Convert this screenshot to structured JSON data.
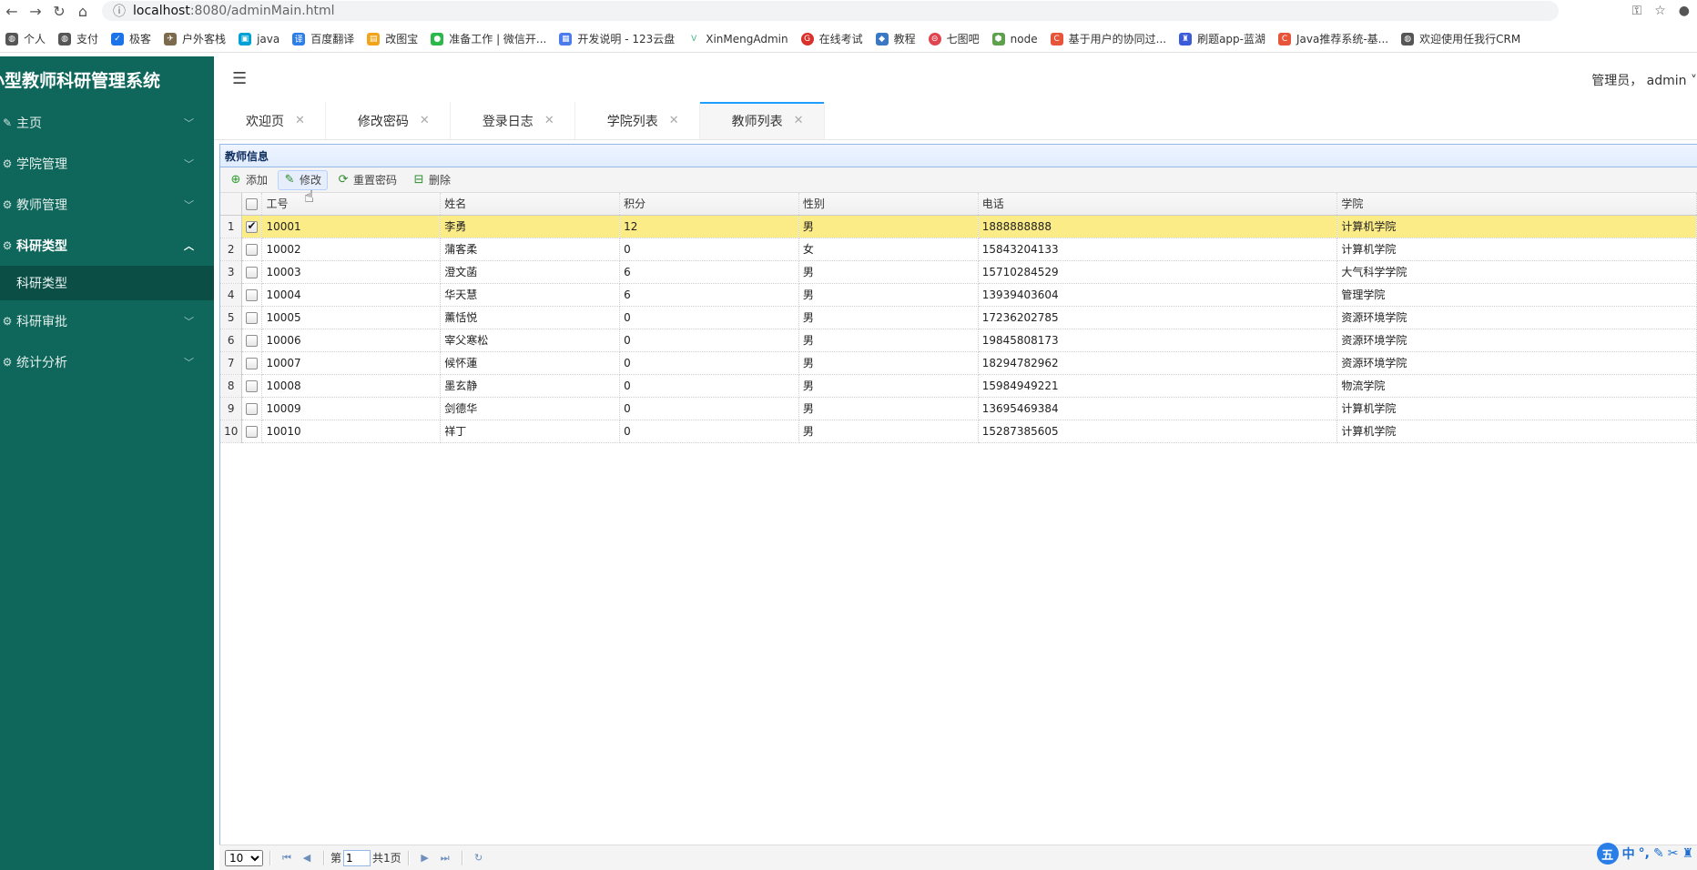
{
  "browser": {
    "url_host": "localhost",
    "url_path": ":8080/adminMain.html",
    "bookmarks": [
      "个人",
      "支付",
      "极客",
      "户外客栈",
      "java",
      "百度翻译",
      "改图宝",
      "准备工作 | 微信开...",
      "开发说明 - 123云盘",
      "XinMengAdmin",
      "在线考试",
      "教程",
      "七图吧",
      "node",
      "基于用户的协同过...",
      "刷题app-蓝湖",
      "Java推荐系统-基...",
      "欢迎使用任我行CRM"
    ]
  },
  "app": {
    "title": "小型教师科研管理系统",
    "user_text": "管理员， admin"
  },
  "sidebar": {
    "items": [
      {
        "label": "主页"
      },
      {
        "label": "学院管理"
      },
      {
        "label": "教师管理"
      },
      {
        "label": "科研类型"
      },
      {
        "label": "科研审批"
      },
      {
        "label": "统计分析"
      }
    ],
    "sub_items": [
      "科研类型"
    ]
  },
  "tabs": [
    "欢迎页",
    "修改密码",
    "登录日志",
    "学院列表",
    "教师列表"
  ],
  "panel": {
    "title": "教师信息",
    "toolbar": {
      "add": "添加",
      "edit": "修改",
      "reset_password": "重置密码",
      "delete": "删除"
    }
  },
  "table": {
    "headers": [
      "工号",
      "姓名",
      "积分",
      "性别",
      "电话",
      "学院"
    ],
    "rows": [
      {
        "no": "1",
        "id": "10001",
        "name": "李勇",
        "score": "12",
        "gender": "男",
        "phone": "1888888888",
        "college": "计算机学院"
      },
      {
        "no": "2",
        "id": "10002",
        "name": "蒲客柔",
        "score": "0",
        "gender": "女",
        "phone": "15843204133",
        "college": "计算机学院"
      },
      {
        "no": "3",
        "id": "10003",
        "name": "澄文菡",
        "score": "6",
        "gender": "男",
        "phone": "15710284529",
        "college": "大气科学学院"
      },
      {
        "no": "4",
        "id": "10004",
        "name": "华天慧",
        "score": "6",
        "gender": "男",
        "phone": "13939403604",
        "college": "管理学院"
      },
      {
        "no": "5",
        "id": "10005",
        "name": "薰恬悦",
        "score": "0",
        "gender": "男",
        "phone": "17236202785",
        "college": "资源环境学院"
      },
      {
        "no": "6",
        "id": "10006",
        "name": "宰父寒松",
        "score": "0",
        "gender": "男",
        "phone": "19845808173",
        "college": "资源环境学院"
      },
      {
        "no": "7",
        "id": "10007",
        "name": "候怀蓮",
        "score": "0",
        "gender": "男",
        "phone": "18294782962",
        "college": "资源环境学院"
      },
      {
        "no": "8",
        "id": "10008",
        "name": "墨玄静",
        "score": "0",
        "gender": "男",
        "phone": "15984949221",
        "college": "物流学院"
      },
      {
        "no": "9",
        "id": "10009",
        "name": "剑德华",
        "score": "0",
        "gender": "男",
        "phone": "13695469384",
        "college": "计算机学院"
      },
      {
        "no": "10",
        "id": "10010",
        "name": "祥丁",
        "score": "0",
        "gender": "男",
        "phone": "15287385605",
        "college": "计算机学院"
      }
    ]
  },
  "pager": {
    "page_size": "10",
    "page_prefix": "第",
    "page": "1",
    "page_total": "共1页"
  },
  "ime": {
    "logo": "中"
  },
  "colors": {
    "sidebar": "#0f665a",
    "selected_row": "#fbec88",
    "active_tab": "#1e9fff"
  }
}
